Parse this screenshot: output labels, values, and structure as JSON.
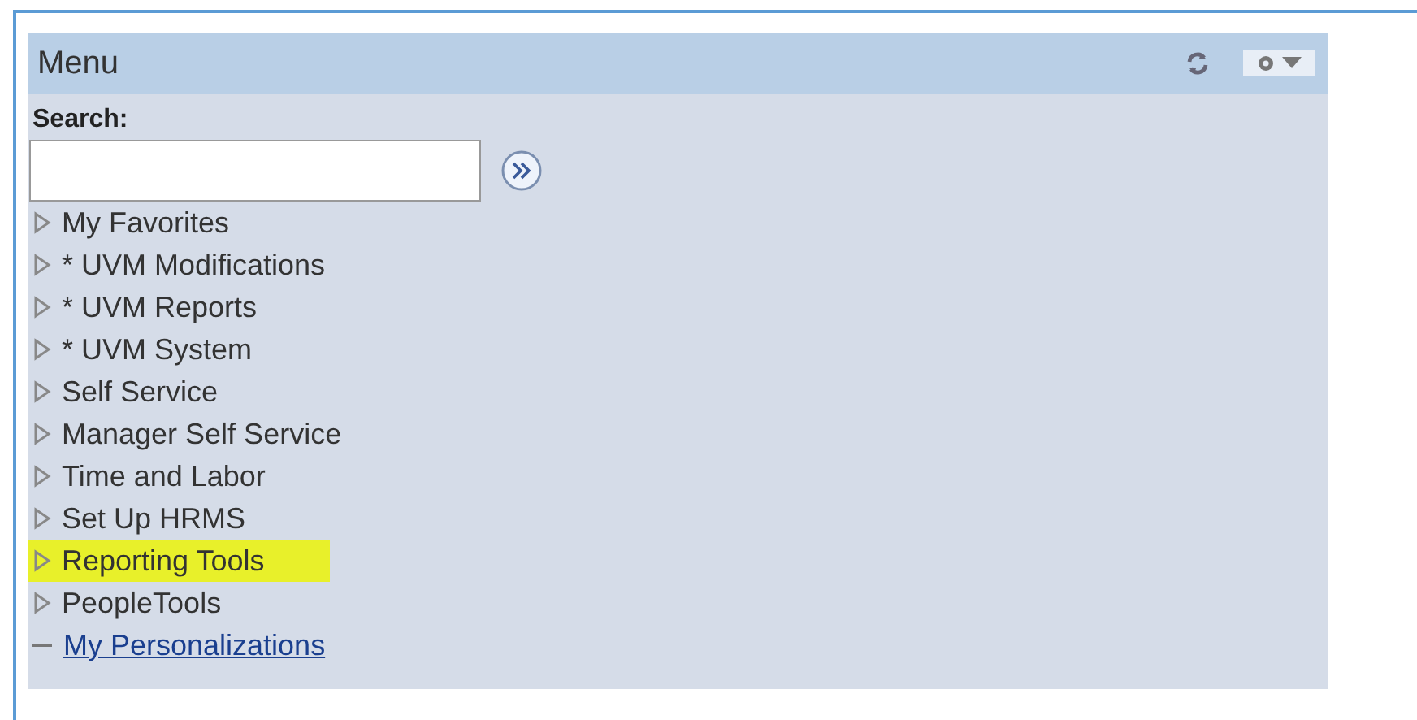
{
  "panel": {
    "title": "Menu"
  },
  "search": {
    "label": "Search:"
  },
  "items": [
    {
      "kind": "folder",
      "label": "My Favorites",
      "highlighted": false
    },
    {
      "kind": "folder",
      "label": "* UVM Modifications",
      "highlighted": false
    },
    {
      "kind": "folder",
      "label": "* UVM Reports",
      "highlighted": false
    },
    {
      "kind": "folder",
      "label": "* UVM System",
      "highlighted": false
    },
    {
      "kind": "folder",
      "label": "Self Service",
      "highlighted": false
    },
    {
      "kind": "folder",
      "label": "Manager Self Service",
      "highlighted": false
    },
    {
      "kind": "folder",
      "label": "Time and Labor",
      "highlighted": false
    },
    {
      "kind": "folder",
      "label": "Set Up HRMS",
      "highlighted": false
    },
    {
      "kind": "folder",
      "label": "Reporting Tools",
      "highlighted": true
    },
    {
      "kind": "folder",
      "label": "PeopleTools",
      "highlighted": false
    },
    {
      "kind": "link",
      "label": "My Personalizations",
      "highlighted": false
    }
  ]
}
